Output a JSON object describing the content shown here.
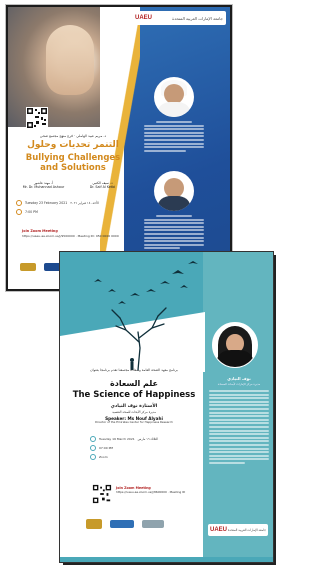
{
  "poster1": {
    "logo_en": "UAEU",
    "logo_ar": "جامعة الإمارات العربية المتحدة",
    "kicker": "د. مريم عبيد الهاملي · فرع منهج مجتمع صحي",
    "title_ar": "التنمر تحديات وحلول",
    "title_en": "Bullying Challenges and Solutions",
    "speaker_left_ar": "أ. مهند عاشور",
    "speaker_left_en": "Mr. Dr. Muhannad Ashour",
    "speaker_right_ar": "د. سيف الكتبي",
    "speaker_right_en": "Dr. Saif Al Ketbi",
    "date_ar": "الأحد، ١٤ فبراير ٢٠٢١",
    "date_en": "Tuesday 23 February 2021",
    "time": "7:00 PM",
    "join_title": "Join Zoom Meeting",
    "join_sub": "https://uaeu-ae.zoom.us/j/9500000 · Meeting ID: 950 0000 0000"
  },
  "poster2": {
    "kicker": "برنامج معهد الصحة العامة وسعادة مجتمعنا تقدم برنامجا بعنوان",
    "title_ar": "علم السعادة",
    "title_en": "The Science of Happiness",
    "speaker_ar": "الأستاذة نوف النيادي",
    "speaker_ar_role": "مديرة مركز الأبحاث للصحة النفسية",
    "speaker_en": "Speaker: Ms Nouf Alyahi",
    "speaker_en_role": "Director of the Emirates Center for Happiness Research",
    "side_name_ar": "نوف النيادي",
    "side_role_ar": "مديرة مركز الإمارات لأبحاث السعادة",
    "date": "Tuesday 16 March 2021",
    "date_ar": "الثلاثاء ١٦ مارس",
    "time": "07:00 PM",
    "platform": "Zoom",
    "join_title": "Join Zoom Meeting",
    "join_sub": "https://uaeu-ae.zoom.us/j/8600000 · Meeting ID",
    "logo_en": "UAEU"
  },
  "colors": {
    "accent_orange": "#d38a1e",
    "blue_panel": "#2f6fb5",
    "teal_panel": "#4aa8b8",
    "join_red": "#b22222"
  }
}
